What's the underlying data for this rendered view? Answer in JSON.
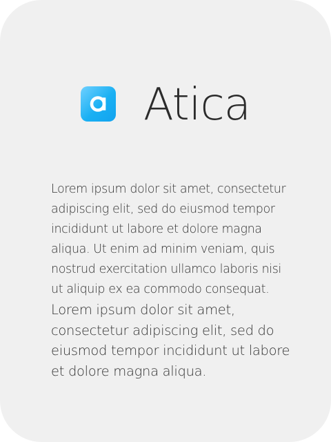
{
  "brand": {
    "name": "Atica",
    "logo_letter": "a",
    "logo_colors": [
      "#6fd0ff",
      "#1ab0f3"
    ]
  },
  "content": {
    "paragraph_1": "Lorem ipsum dolor sit amet, consectetur adipiscing elit, sed do eiusmod tempor incididunt ut labore et dolore magna aliqua. Ut enim ad minim veniam, quis nostrud exercitation ullamco laboris nisi ut aliquip ex ea commodo consequat.",
    "paragraph_2": "Lorem ipsum dolor sit amet, consectetur adipiscing elit, sed do eiusmod tempor incididunt ut labore et dolore magna aliqua."
  }
}
